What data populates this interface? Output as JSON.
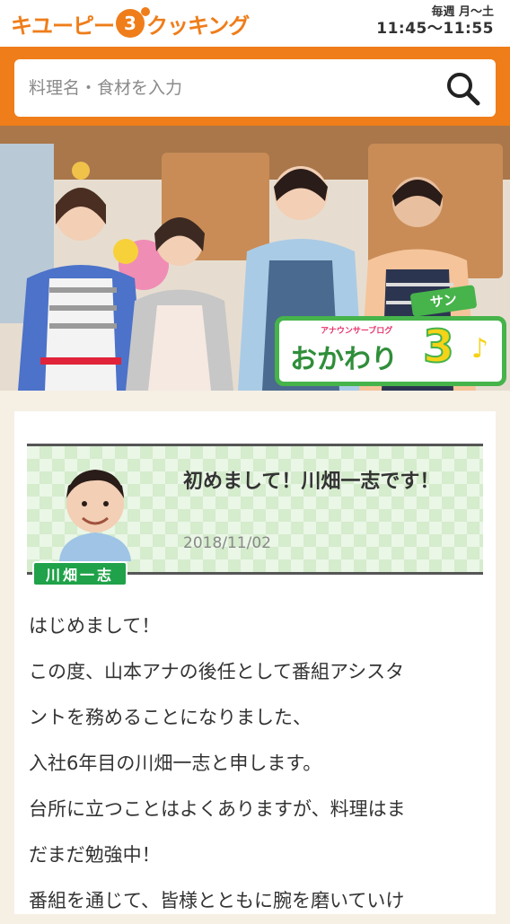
{
  "header": {
    "logo_part1": "キユーピー",
    "logo_badge": "3",
    "logo_part2": "クッキング",
    "schedule_days": "毎週 月～土",
    "schedule_time": "11:45～11:55"
  },
  "search": {
    "placeholder": "料理名・食材を入力",
    "icon": "search-icon"
  },
  "hero": {
    "badge_small": "アナウンサーブログ",
    "badge_main": "おかわり",
    "badge_number": "3",
    "badge_note": "♪",
    "badge_tag": "サン"
  },
  "post": {
    "author": "川畑一志",
    "title": "初めまして！川畑一志です！",
    "date": "2018/11/02",
    "body": [
      "はじめまして！",
      "この度、山本アナの後任として番組アシスタ",
      "ントを務めることになりました、",
      "入社6年目の川畑一志と申します。",
      "台所に立つことはよくありますが、料理はま",
      "だまだ勉強中！",
      "番組を通じて、皆様とともに腕を磨いていけ"
    ]
  },
  "colors": {
    "brand_orange": "#ef7d1a",
    "green": "#1fa249",
    "background": "#f6efe4"
  }
}
